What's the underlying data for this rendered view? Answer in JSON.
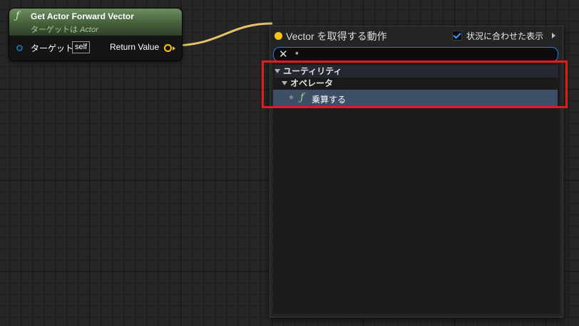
{
  "node": {
    "fn_icon": "ƒ",
    "title": "Get Actor Forward Vector",
    "subtitle_prefix": "ターゲットは ",
    "subtitle_class": "Actor",
    "target_label": "ターゲット",
    "target_default": "self",
    "return_label": "Return Value",
    "header_color": "#45603a",
    "target_pin_color": "#1c6a9e",
    "vector_pin_color": "#f5c518"
  },
  "menu": {
    "title": "Vector を取得する動作",
    "context_sensitive_label": "状況に合わせた表示",
    "context_sensitive_checked": true,
    "search_value": "*",
    "search_placeholder": "",
    "tree": {
      "category": "ユーティリティ",
      "subcategory": "オペレータ",
      "selected_item": "乗算する",
      "item_icon": "ƒ",
      "fav_icon": "★"
    }
  },
  "highlight_color": "#e31b1b"
}
